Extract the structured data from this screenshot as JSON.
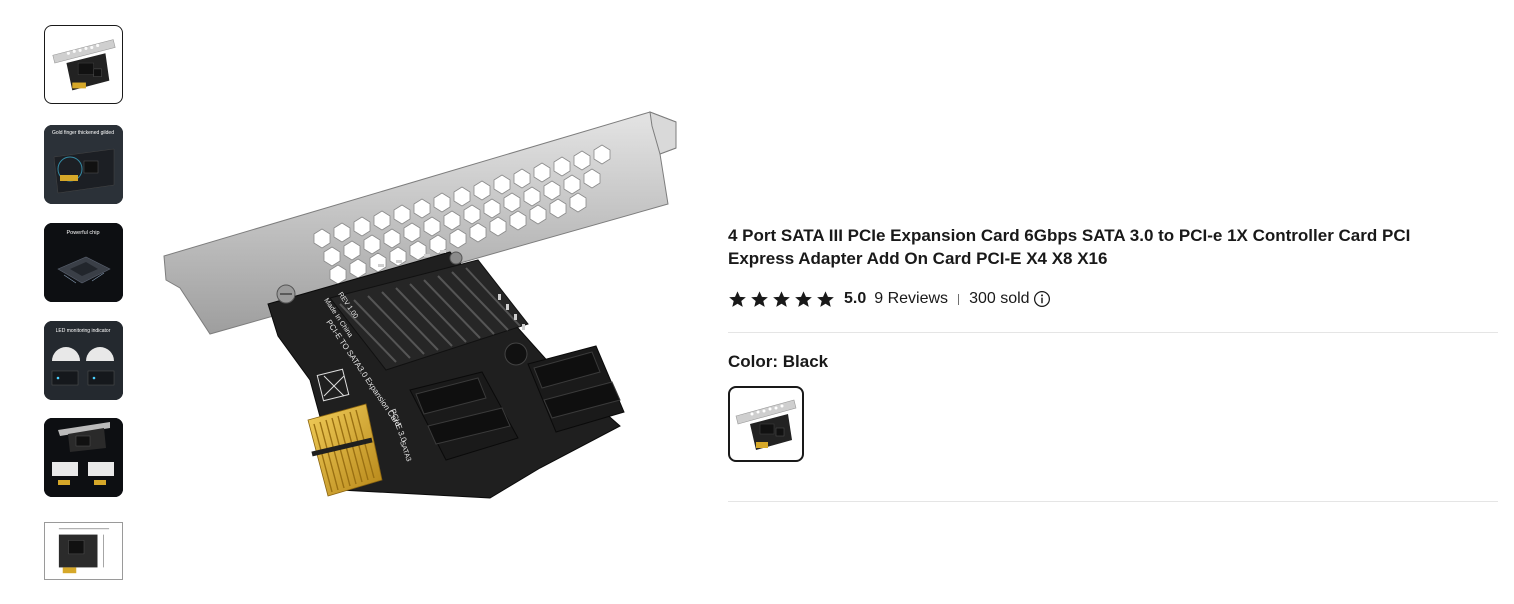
{
  "gallery": {
    "thumbnails": [
      {
        "icon": "product-card-thumbnail",
        "selected": true
      },
      {
        "icon": "gold-finger-thumbnail",
        "caption": "Gold finger thickened gilded"
      },
      {
        "icon": "chip-thumbnail",
        "caption": "Powerful chip"
      },
      {
        "icon": "led-indicator-thumbnail",
        "caption": "LED monitoring indicator"
      },
      {
        "icon": "card-variants-thumbnail"
      },
      {
        "icon": "dimension-diagram-thumbnail"
      }
    ],
    "main_image": {
      "icon": "sata-pcie-card-photo",
      "board_text": {
        "rev": "REV 1.00",
        "made": "Made In China",
        "name": "PCI-E TO SATA3.0 Expansion Card",
        "pcie": "PCI-E 3.0",
        "sata": "SATA3"
      }
    }
  },
  "product": {
    "title": "4 Port SATA III PCIe Expansion Card 6Gbps SATA 3.0 to PCI-e 1X Controller Card PCI Express Adapter Add On Card PCI-E X4 X8 X16",
    "rating": {
      "stars": 5,
      "value": "5.0",
      "reviews": "9 Reviews",
      "sold": "300 sold"
    },
    "color": {
      "label": "Color: Black",
      "options": [
        {
          "name": "Black",
          "selected": true
        }
      ]
    }
  },
  "colors": {
    "text": "#191919",
    "divider": "#e5e5e5",
    "star": "#191919",
    "pcb": "#1f1f1f",
    "bracket": "#c9c9c9",
    "gold": "#d6a829"
  }
}
